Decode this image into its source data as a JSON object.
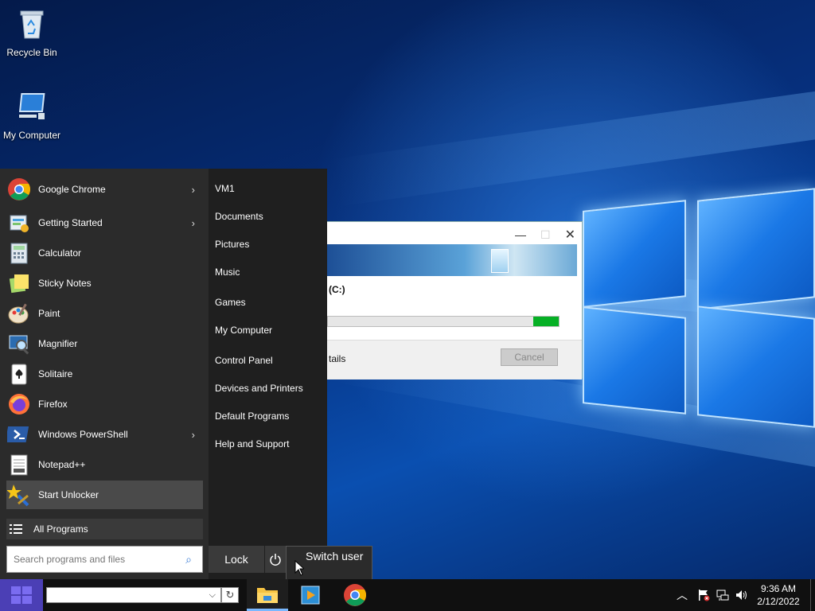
{
  "desktop": {
    "icons": [
      {
        "label": "Recycle Bin",
        "icon": "recycle-bin-icon"
      },
      {
        "label": "My Computer",
        "icon": "computer-icon"
      }
    ]
  },
  "dialog": {
    "drive_text": "(C:)",
    "details_text": "tails",
    "cancel_label": "Cancel",
    "progress": 0.11,
    "progress_color": "#06b025"
  },
  "start_menu": {
    "programs": [
      {
        "label": "Google Chrome",
        "icon": "chrome-icon",
        "submenu": true
      },
      {
        "label": "Getting Started",
        "icon": "getting-started-icon",
        "submenu": true
      },
      {
        "label": "Calculator",
        "icon": "calculator-icon",
        "submenu": false
      },
      {
        "label": "Sticky Notes",
        "icon": "sticky-notes-icon",
        "submenu": false
      },
      {
        "label": "Paint",
        "icon": "paint-icon",
        "submenu": false
      },
      {
        "label": "Magnifier",
        "icon": "magnifier-icon",
        "submenu": false
      },
      {
        "label": "Solitaire",
        "icon": "solitaire-icon",
        "submenu": false
      },
      {
        "label": "Firefox",
        "icon": "firefox-icon",
        "submenu": false
      },
      {
        "label": "Windows PowerShell",
        "icon": "powershell-icon",
        "submenu": true
      },
      {
        "label": "Notepad++",
        "icon": "notepadpp-icon",
        "submenu": false
      },
      {
        "label": "Start Unlocker",
        "icon": "unlocker-icon",
        "submenu": false,
        "highlighted": true
      }
    ],
    "all_programs_label": "All Programs",
    "search_placeholder": "Search programs and files",
    "places": [
      "VM1",
      "Documents",
      "Pictures",
      "Music",
      "Games",
      "My Computer",
      "Control Panel",
      "Devices and Printers",
      "Default Programs",
      "Help and Support"
    ],
    "lock_label": "Lock",
    "power_tooltip": "Switch user"
  },
  "taskbar": {
    "start_color": "#4b3fb5",
    "address_value": "",
    "apps": [
      {
        "name": "file-explorer",
        "icon": "folder-icon",
        "active": true
      },
      {
        "name": "media-player",
        "icon": "media-player-icon",
        "active": false
      },
      {
        "name": "chrome",
        "icon": "chrome-icon",
        "active": false
      }
    ],
    "clock_time": "9:36 AM",
    "clock_date": "2/12/2022"
  }
}
